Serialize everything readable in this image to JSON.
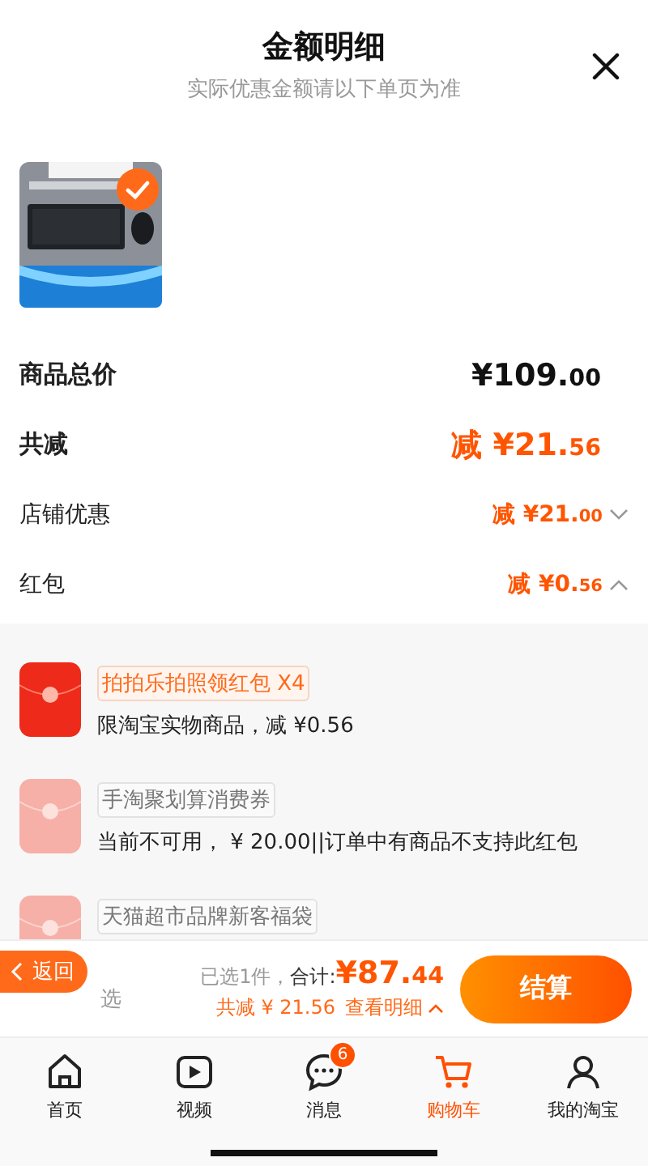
{
  "header": {
    "title": "金额明细",
    "subtitle": "实际优惠金额请以下单页为准"
  },
  "product": {
    "checked": true
  },
  "summary": [
    {
      "label": "商品总价",
      "amount": "¥109.00",
      "kind": "total"
    },
    {
      "label": "共减",
      "amount": "减 ¥21.56",
      "kind": "discount"
    },
    {
      "label": "店铺优惠",
      "amount": "减 ¥21.00",
      "kind": "sub",
      "expanded": false
    },
    {
      "label": "红包",
      "amount": "减 ¥0.56",
      "kind": "sub",
      "expanded": true
    }
  ],
  "red_packets": [
    {
      "tag": "拍拍乐拍照领红包 X4",
      "note": "限淘宝实物商品，减 ¥0.56",
      "disabled": false
    },
    {
      "tag": "手淘聚划算消费券",
      "note": "当前不可用， ¥ 20.00||订单中有商品不支持此红包",
      "disabled": true
    },
    {
      "tag": "天猫超市品牌新客福袋",
      "disabled": true
    }
  ],
  "footer": {
    "back": "返回",
    "select_all": "选",
    "selected_count": "已选1件，",
    "total_label": "合计:",
    "total": "¥87.44",
    "saved": "共减 ¥ 21.56",
    "details": "查看明细",
    "checkout": "结算"
  },
  "tabs": [
    {
      "label": "首页",
      "selected": false
    },
    {
      "label": "视频",
      "selected": false
    },
    {
      "label": "消息",
      "selected": false,
      "badge": "6"
    },
    {
      "label": "购物车",
      "selected": true
    },
    {
      "label": "我的淘宝",
      "selected": false
    }
  ]
}
